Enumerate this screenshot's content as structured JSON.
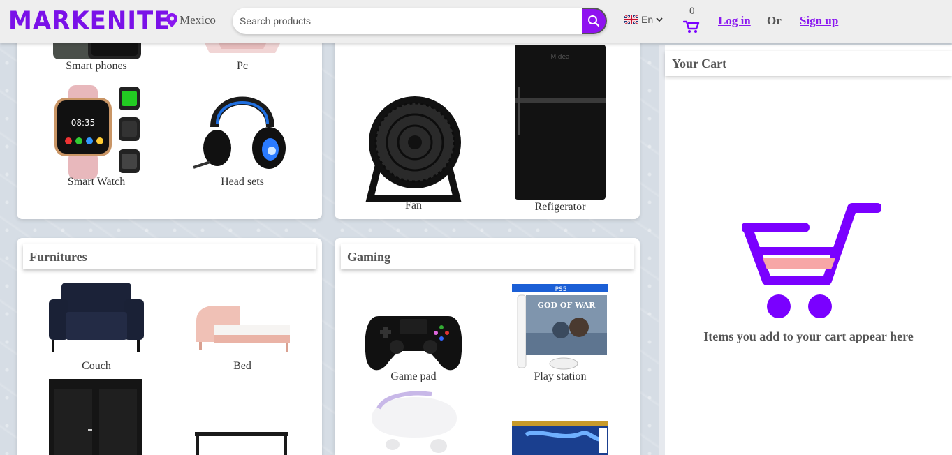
{
  "header": {
    "logo": "MARKENITE",
    "location": "Mexico",
    "search_placeholder": "Search products",
    "language": "En",
    "cart_count": "0",
    "login": "Log in",
    "or": "Or",
    "signup": "Sign up"
  },
  "sections": [
    {
      "id": "electronics",
      "products": [
        {
          "label": "Smart phones"
        },
        {
          "label": "Pc"
        },
        {
          "label": "Smart Watch"
        },
        {
          "label": "Head sets"
        }
      ]
    },
    {
      "id": "appliances",
      "products": [
        {
          "label": "Fan"
        },
        {
          "label": "Refigerator"
        }
      ]
    },
    {
      "id": "furnitures",
      "title": "Furnitures",
      "products": [
        {
          "label": "Couch"
        },
        {
          "label": "Bed"
        }
      ]
    },
    {
      "id": "gaming",
      "title": "Gaming",
      "products": [
        {
          "label": "Game pad"
        },
        {
          "label": "Play station"
        }
      ]
    }
  ],
  "cart": {
    "title": "Your Cart",
    "empty_text": "Items you add to your cart appear here"
  },
  "colors": {
    "brand": "#7a11e8",
    "cart_icon": "#7a00ff",
    "cart_fill": "#f7a6a6"
  }
}
